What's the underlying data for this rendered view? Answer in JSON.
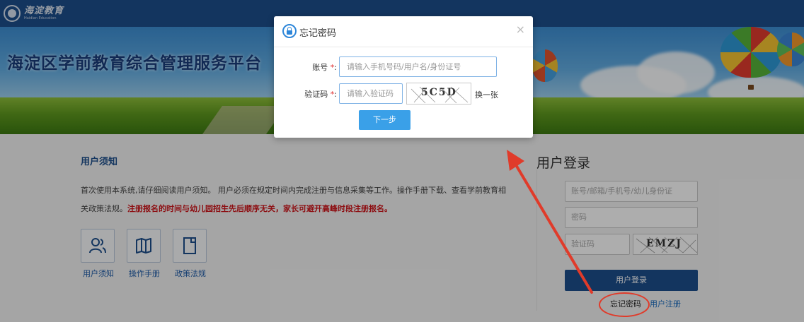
{
  "header": {
    "logo_cn": "海淀教育",
    "logo_en": "Haidian Education"
  },
  "banner": {
    "title": "海淀区学前教育综合管理服务平台"
  },
  "notice": {
    "title": "用户须知",
    "text_normal": "首次使用本系统,请仔细阅读用户须知。 用户必须在规定时间内完成注册与信息采集等工作。操作手册下载、查看学前教育相关政策法规。",
    "text_red": "注册报名的时间与幼儿园招生先后顺序无关，家长可避开高峰时段注册报名。",
    "links": [
      {
        "label": "用户须知",
        "icon": "user-icon"
      },
      {
        "label": "操作手册",
        "icon": "book-icon"
      },
      {
        "label": "政策法规",
        "icon": "document-icon"
      }
    ]
  },
  "login": {
    "title": "用户登录",
    "account_placeholder": "账号/邮箱/手机号/幼儿身份证",
    "password_placeholder": "密码",
    "captcha_placeholder": "验证码",
    "captcha_text": "EMZJ",
    "submit_label": "用户登录",
    "forgot_label": "忘记密码",
    "register_label": "用户注册"
  },
  "modal": {
    "title": "忘记密码",
    "close": "×",
    "account_label": "账号",
    "account_placeholder": "请输入手机号码/用户名/身份证号",
    "captcha_label": "验证码",
    "required_mark": "*",
    "colon": ":",
    "captcha_placeholder": "请输入验证码",
    "captcha_text": "5C5D",
    "refresh_label": "换一张",
    "next_label": "下一步"
  },
  "colors": {
    "header_blue": "#1d4f8c",
    "link_blue": "#1d6ec0",
    "button_blue": "#3aa0e8",
    "alert_red": "#d0161b",
    "annotation_red": "#e03b2a"
  }
}
